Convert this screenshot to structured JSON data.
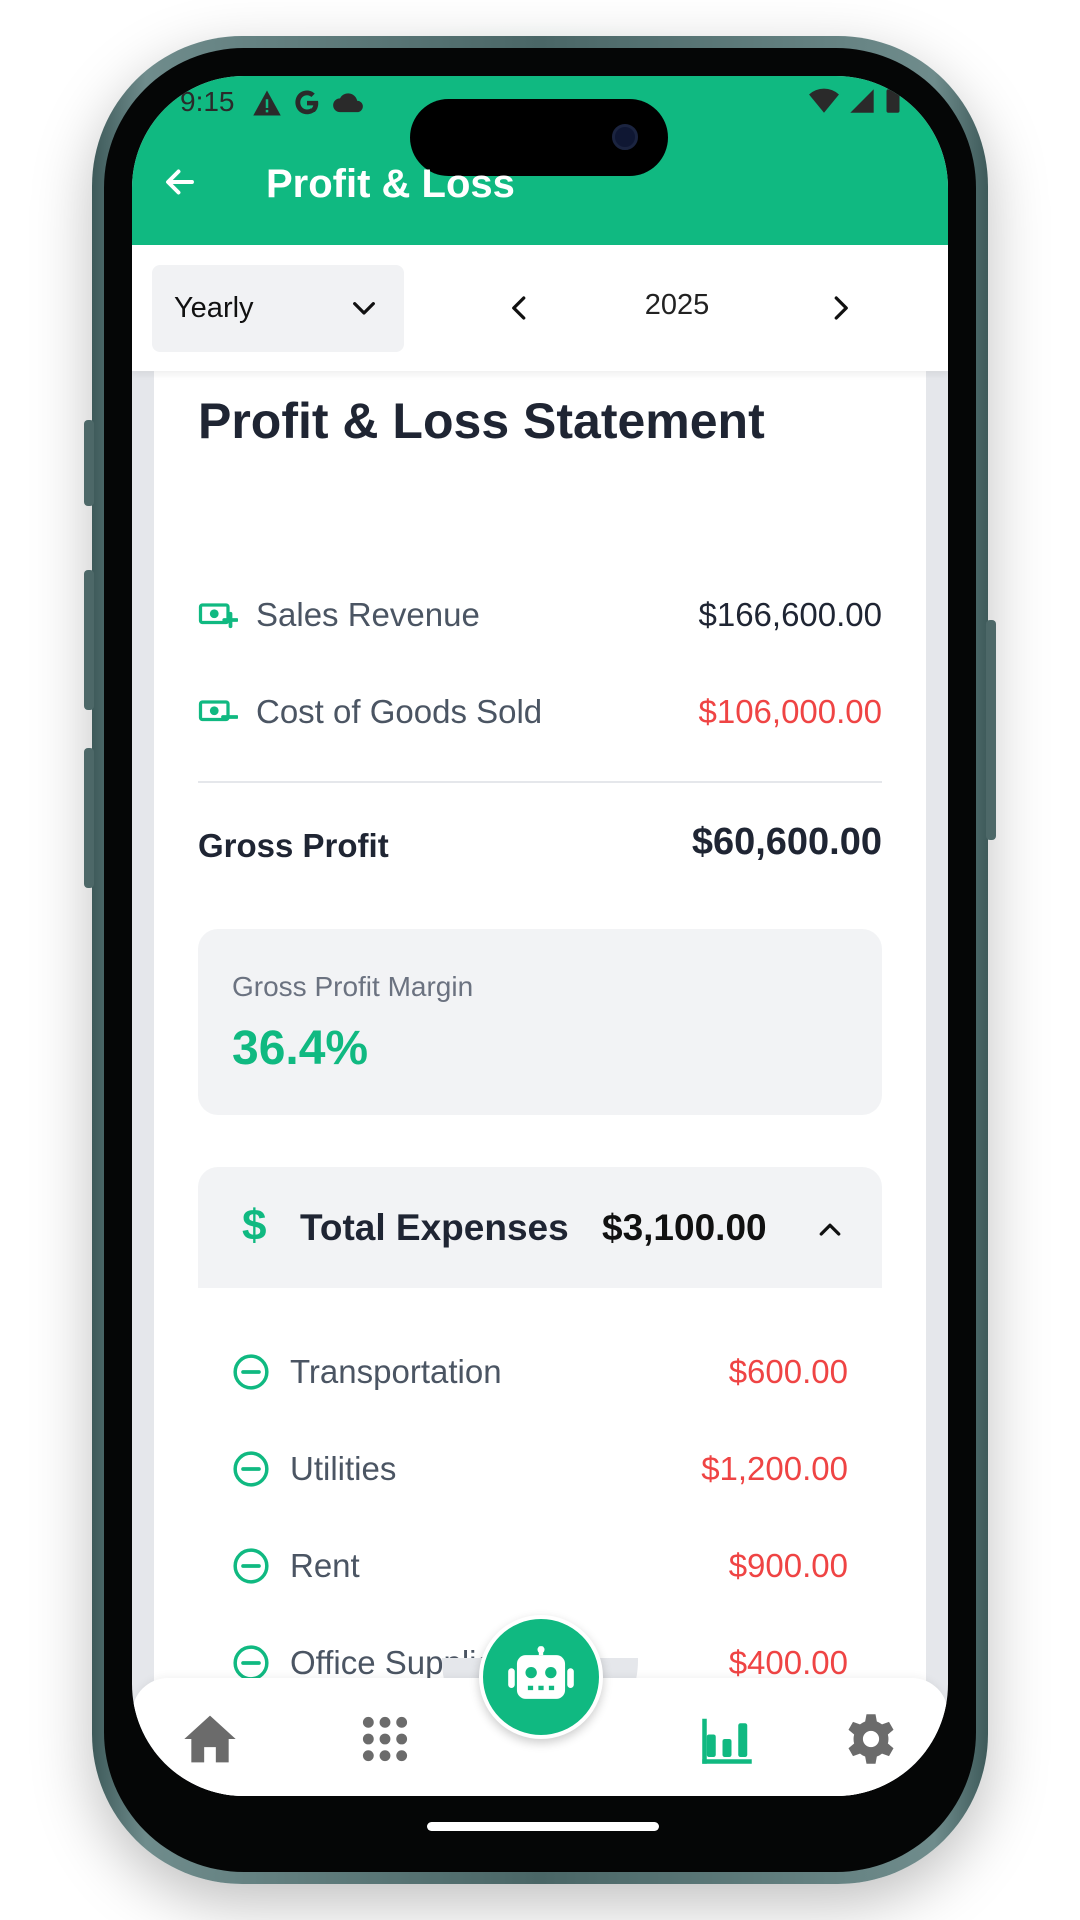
{
  "status_bar": {
    "time": "9:15"
  },
  "app_bar": {
    "title": "Profit & Loss",
    "back_icon": "arrow-left-icon"
  },
  "toolbar": {
    "period_selected": "Yearly",
    "year": "2025"
  },
  "statement": {
    "title": "Profit & Loss Statement",
    "sales_revenue": {
      "label": "Sales Revenue",
      "value": "$166,600.00",
      "icon": "money-plus-icon"
    },
    "cogs": {
      "label": "Cost of Goods Sold",
      "value": "$106,000.00",
      "icon": "money-minus-icon"
    },
    "gross_profit": {
      "label": "Gross Profit",
      "value": "$60,600.00"
    },
    "gross_margin": {
      "label": "Gross Profit Margin",
      "value": "36.4%"
    },
    "expenses": {
      "symbol": "$",
      "title": "Total Expenses",
      "total": "$3,100.00",
      "items": [
        {
          "label": "Transportation",
          "value": "$600.00"
        },
        {
          "label": "Utilities",
          "value": "$1,200.00"
        },
        {
          "label": "Rent",
          "value": "$900.00"
        },
        {
          "label": "Office Supplies",
          "value": "$400.00"
        }
      ]
    }
  },
  "bottom_nav": {
    "items": [
      "home-icon",
      "apps-grid-icon",
      "robot-icon",
      "bar-chart-icon",
      "gear-icon"
    ],
    "active": "bar-chart-icon"
  },
  "colors": {
    "primary": "#10b981",
    "negative": "#ef4444",
    "text_dark": "#1f2533",
    "text_muted": "#4b5563"
  }
}
